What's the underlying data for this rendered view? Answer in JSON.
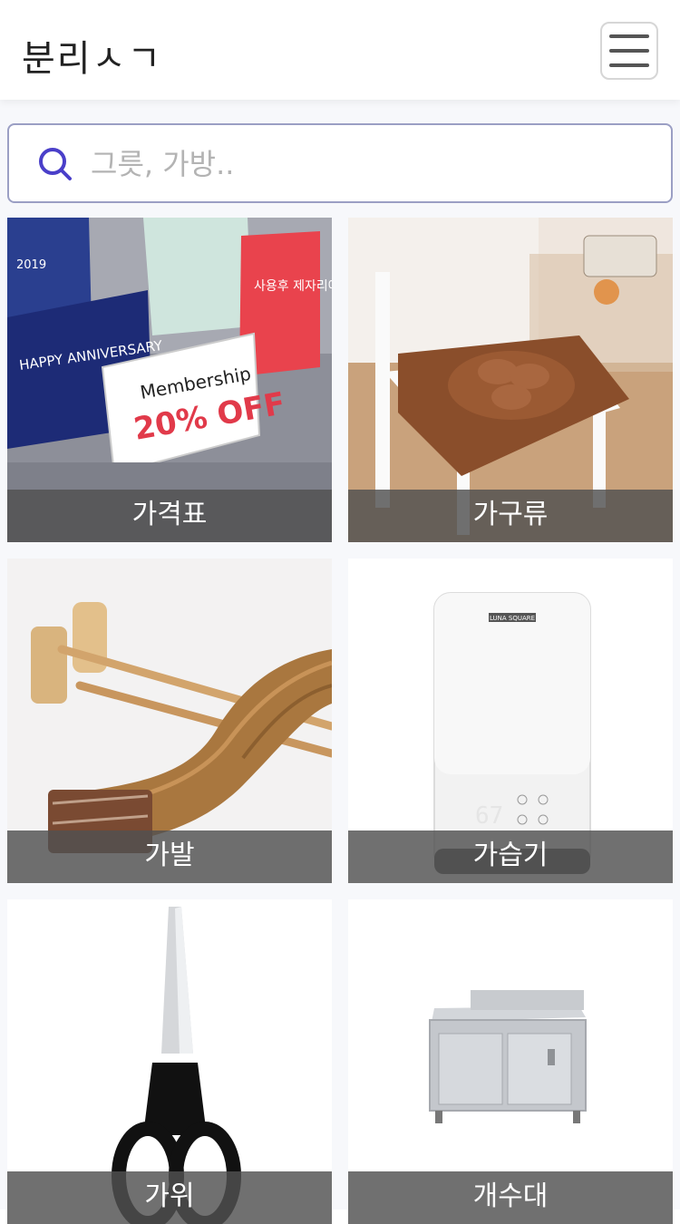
{
  "header": {
    "logo": "분리ㅅㄱ",
    "menu_icon": "hamburger-menu-icon"
  },
  "search": {
    "icon": "search-icon",
    "placeholder": "그릇, 가방..",
    "value": ""
  },
  "categories": [
    {
      "label": "가격표",
      "image": "price-tag-stands-image"
    },
    {
      "label": "가구류",
      "image": "chair-cushion-image"
    },
    {
      "label": "가발",
      "image": "hair-extension-image"
    },
    {
      "label": "가습기",
      "image": "humidifier-image"
    },
    {
      "label": "가위",
      "image": "scissors-image"
    },
    {
      "label": "개수대",
      "image": "sink-cabinet-image"
    }
  ],
  "image_text": {
    "membership": "Membership",
    "discount": "20% OFF",
    "anniversary": "HAPPY ANNIVERSARY",
    "sign": "사용후 제자리에 놓아주세요",
    "brand": "LUNA SQUARE",
    "year": "2019"
  },
  "colors": {
    "accent": "#4a3fc9",
    "label_bg": "#505050",
    "border": "#9b9fc4"
  }
}
